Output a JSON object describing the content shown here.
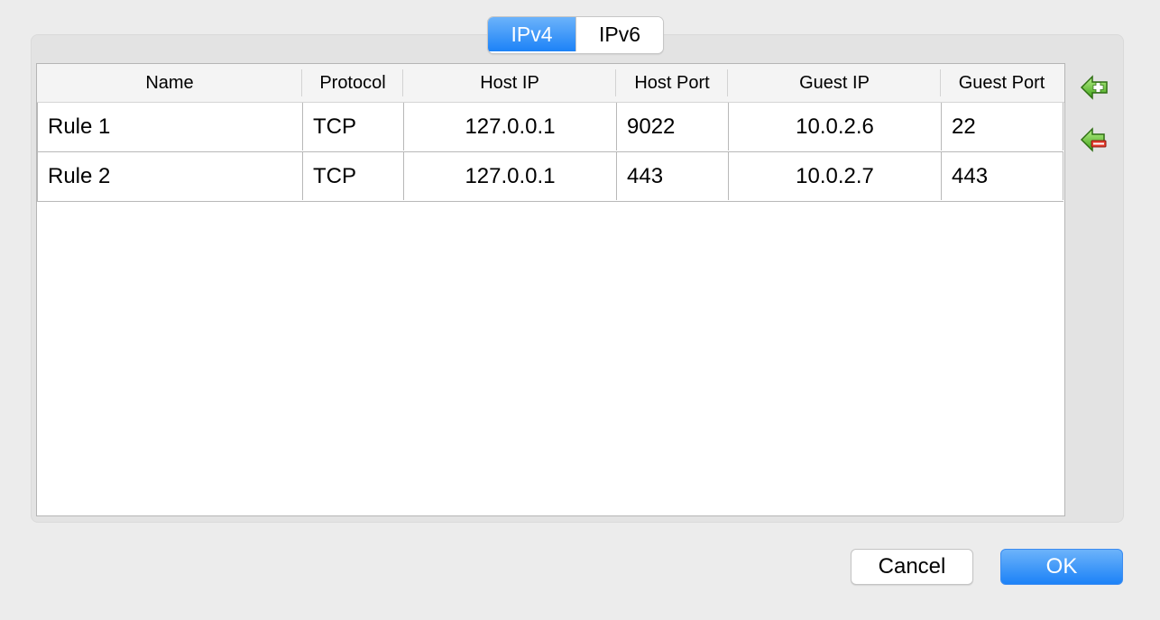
{
  "tabs": {
    "ipv4_label": "IPv4",
    "ipv6_label": "IPv6",
    "selected": "IPv4"
  },
  "table": {
    "columns": [
      "Name",
      "Protocol",
      "Host IP",
      "Host Port",
      "Guest IP",
      "Guest Port"
    ],
    "rows": [
      [
        "Rule 1",
        "TCP",
        "127.0.0.1",
        "9022",
        "10.0.2.6",
        "22"
      ],
      [
        "Rule 2",
        "TCP",
        "127.0.0.1",
        "443",
        "10.0.2.7",
        "443"
      ]
    ]
  },
  "side_buttons": {
    "add_icon": "add-rule-icon",
    "remove_icon": "remove-rule-icon"
  },
  "footer": {
    "cancel_label": "Cancel",
    "ok_label": "OK"
  },
  "colors": {
    "accent_blue": "#1c82f7",
    "window_bg": "#ececec"
  }
}
